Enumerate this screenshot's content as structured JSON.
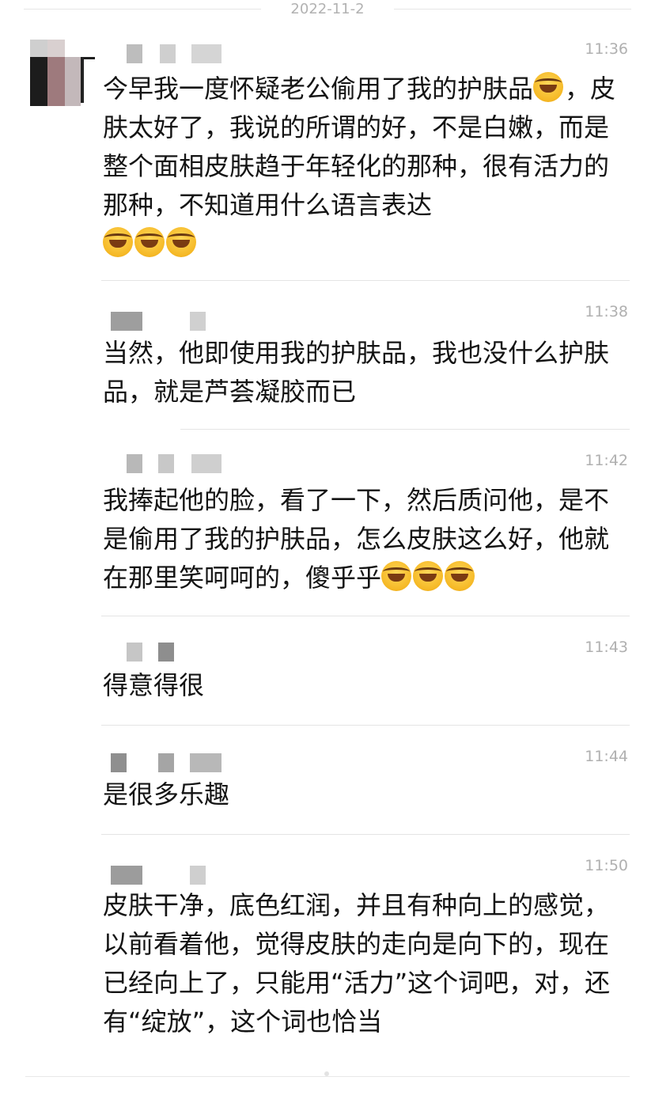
{
  "date_separator": "2022-11-2",
  "messages": [
    {
      "time": "11:36",
      "text": "今早我一度怀疑老公偷用了我的护肤品",
      "emoji_after_first": 1,
      "text_b": "，皮肤太好了，我说的所谓的好，不是白嫩，而是整个面相皮肤趋于年轻化的那种，很有活力的那种，不知道用什么语言表达",
      "emoji_end": 3
    },
    {
      "time": "11:38",
      "text": "当然，他即使用我的护肤品，我也没什么护肤品，就是芦荟凝胶而已"
    },
    {
      "time": "11:42",
      "text": "我捧起他的脸，看了一下，然后质问他，是不是偷用了我的护肤品，怎么皮肤这么好，他就在那里笑呵呵的，傻乎乎",
      "emoji_end": 3
    },
    {
      "time": "11:43",
      "text": "得意得很"
    },
    {
      "time": "11:44",
      "text": "是很多乐趣"
    },
    {
      "time": "11:50",
      "text": "皮肤干净，底色红润，并且有种向上的感觉，以前看着他，觉得皮肤的走向是向下的，现在已经向上了，只能用“活力”这个词吧，对，还有“绽放”，这个词也恰当"
    }
  ],
  "icons": {
    "emoji": "loudly-crying-face-emoji"
  }
}
